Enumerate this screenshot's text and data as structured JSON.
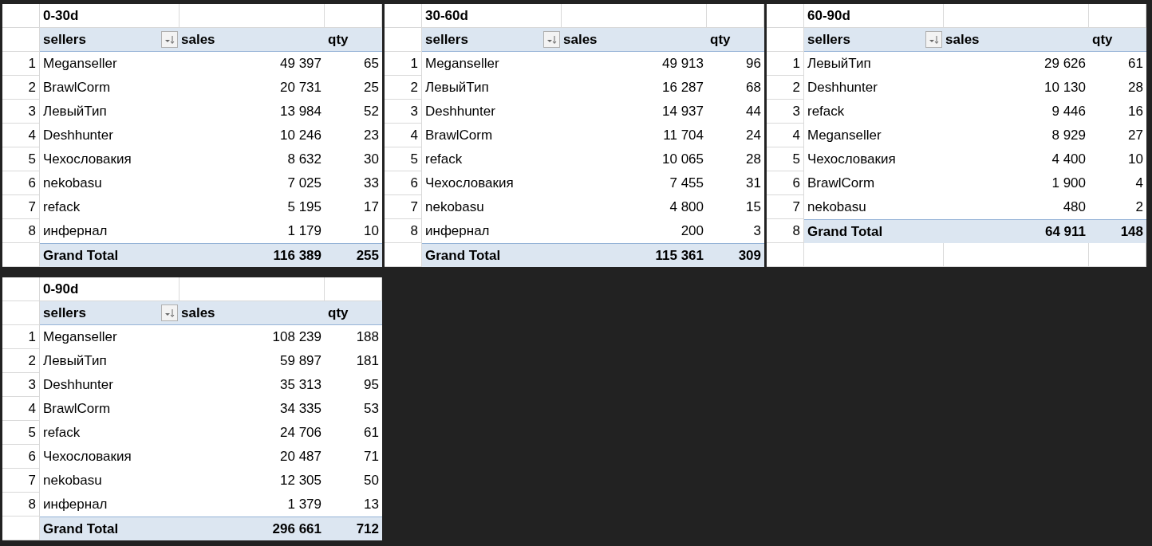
{
  "pivots": [
    {
      "title": "0-30d",
      "columns": [
        "sellers",
        "sales",
        "qty"
      ],
      "rows": [
        {
          "num": "1",
          "seller": "Meganseller",
          "sales": "49 397",
          "qty": "65"
        },
        {
          "num": "2",
          "seller": "BrawlCorm",
          "sales": "20 731",
          "qty": "25"
        },
        {
          "num": "3",
          "seller": "ЛевыйТип",
          "sales": "13 984",
          "qty": "52"
        },
        {
          "num": "4",
          "seller": "Deshhunter",
          "sales": "10 246",
          "qty": "23"
        },
        {
          "num": "5",
          "seller": "Чехословакия",
          "sales": "8 632",
          "qty": "30"
        },
        {
          "num": "6",
          "seller": "nekobasu",
          "sales": "7 025",
          "qty": "33"
        },
        {
          "num": "7",
          "seller": "refack",
          "sales": "5 195",
          "qty": "17"
        },
        {
          "num": "8",
          "seller": "инфернал",
          "sales": "1 179",
          "qty": "10"
        }
      ],
      "total": {
        "label": "Grand Total",
        "sales": "116 389",
        "qty": "255"
      }
    },
    {
      "title": "30-60d",
      "columns": [
        "sellers",
        "sales",
        "qty"
      ],
      "rows": [
        {
          "num": "1",
          "seller": "Meganseller",
          "sales": "49 913",
          "qty": "96"
        },
        {
          "num": "2",
          "seller": "ЛевыйТип",
          "sales": "16 287",
          "qty": "68"
        },
        {
          "num": "3",
          "seller": "Deshhunter",
          "sales": "14 937",
          "qty": "44"
        },
        {
          "num": "4",
          "seller": "BrawlCorm",
          "sales": "11 704",
          "qty": "24"
        },
        {
          "num": "5",
          "seller": "refack",
          "sales": "10 065",
          "qty": "28"
        },
        {
          "num": "6",
          "seller": "Чехословакия",
          "sales": "7 455",
          "qty": "31"
        },
        {
          "num": "7",
          "seller": "nekobasu",
          "sales": "4 800",
          "qty": "15"
        },
        {
          "num": "8",
          "seller": "инфернал",
          "sales": "200",
          "qty": "3"
        }
      ],
      "total": {
        "label": "Grand Total",
        "sales": "115 361",
        "qty": "309"
      }
    },
    {
      "title": "60-90d",
      "columns": [
        "sellers",
        "sales",
        "qty"
      ],
      "rows": [
        {
          "num": "1",
          "seller": "ЛевыйТип",
          "sales": "29 626",
          "qty": "61"
        },
        {
          "num": "2",
          "seller": "Deshhunter",
          "sales": "10 130",
          "qty": "28"
        },
        {
          "num": "3",
          "seller": "refack",
          "sales": "9 446",
          "qty": "16"
        },
        {
          "num": "4",
          "seller": "Meganseller",
          "sales": "8 929",
          "qty": "27"
        },
        {
          "num": "5",
          "seller": "Чехословакия",
          "sales": "4 400",
          "qty": "10"
        },
        {
          "num": "6",
          "seller": "BrawlCorm",
          "sales": "1 900",
          "qty": "4"
        },
        {
          "num": "7",
          "seller": "nekobasu",
          "sales": "480",
          "qty": "2"
        }
      ],
      "total": {
        "num": "8",
        "label": "Grand Total",
        "sales": "64 911",
        "qty": "148"
      }
    },
    {
      "title": "0-90d",
      "columns": [
        "sellers",
        "sales",
        "qty"
      ],
      "rows": [
        {
          "num": "1",
          "seller": "Meganseller",
          "sales": "108 239",
          "qty": "188"
        },
        {
          "num": "2",
          "seller": "ЛевыйТип",
          "sales": "59 897",
          "qty": "181"
        },
        {
          "num": "3",
          "seller": "Deshhunter",
          "sales": "35 313",
          "qty": "95"
        },
        {
          "num": "4",
          "seller": "BrawlCorm",
          "sales": "34 335",
          "qty": "53"
        },
        {
          "num": "5",
          "seller": "refack",
          "sales": "24 706",
          "qty": "61"
        },
        {
          "num": "6",
          "seller": "Чехословакия",
          "sales": "20 487",
          "qty": "71"
        },
        {
          "num": "7",
          "seller": "nekobasu",
          "sales": "12 305",
          "qty": "50"
        },
        {
          "num": "8",
          "seller": "инфернал",
          "sales": "1 379",
          "qty": "13"
        }
      ],
      "total": {
        "label": "Grand Total",
        "sales": "296 661",
        "qty": "712"
      }
    }
  ]
}
